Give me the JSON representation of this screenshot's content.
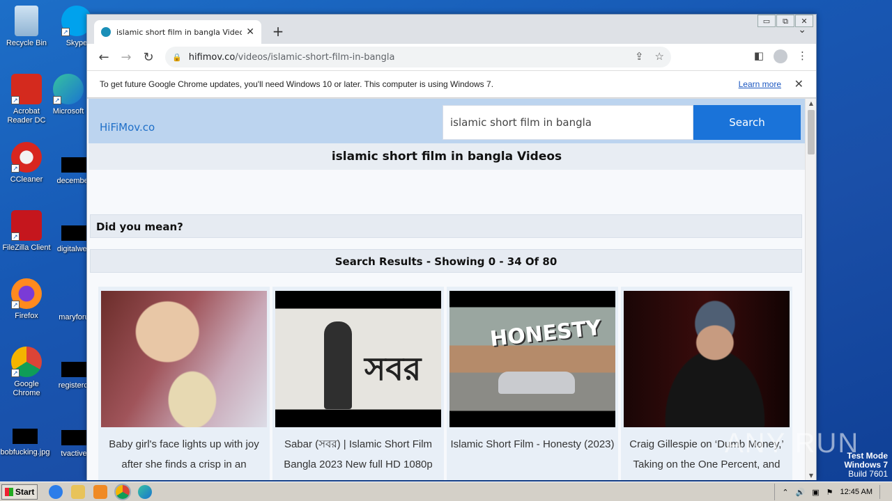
{
  "desktop": {
    "icons": [
      {
        "label": "Recycle Bin",
        "name": "recycle-bin-icon"
      },
      {
        "label": "Acrobat Reader DC",
        "name": "acrobat-icon"
      },
      {
        "label": "CCleaner",
        "name": "ccleaner-icon"
      },
      {
        "label": "FileZilla Client",
        "name": "filezilla-icon"
      },
      {
        "label": "Firefox",
        "name": "firefox-icon"
      },
      {
        "label": "Google Chrome",
        "name": "chrome-icon"
      },
      {
        "label": "bobfucking.jpg",
        "name": "file-icon"
      },
      {
        "label": "Skype",
        "name": "skype-icon"
      },
      {
        "label": "Microsoft",
        "name": "edge-icon"
      },
      {
        "label": "december",
        "name": "file-icon"
      },
      {
        "label": "digitalwes",
        "name": "file-icon"
      },
      {
        "label": "maryforu",
        "name": "file-icon"
      },
      {
        "label": "registercl",
        "name": "file-icon"
      },
      {
        "label": "tvactive",
        "name": "file-icon"
      }
    ]
  },
  "window": {
    "controls": [
      "▭",
      "⧉",
      "✕"
    ]
  },
  "browser": {
    "tab_title": "islamic short film in bangla Videos - H",
    "tab_close": "✕",
    "new_tab": "+",
    "tab_dropdown": "⌄",
    "back": "←",
    "forward": "→",
    "reload": "↻",
    "url_host": "hifimov.co",
    "url_path": "/videos/islamic-short-film-in-bangla",
    "infobar_text": "To get future Google Chrome updates, you'll need Windows 10 or later. This computer is using Windows 7.",
    "infobar_link": "Learn more",
    "infobar_close": "✕"
  },
  "site": {
    "logo": "HiFiMov.co",
    "search_value": "islamic short film in bangla",
    "search_button": "Search",
    "page_title": "islamic short film in bangla Videos",
    "did_you_mean": "Did you mean?",
    "results_summary": "Search Results - Showing 0 - 34 Of 80",
    "videos": [
      {
        "title": "Baby girl's face lights up with joy after she finds a crisp in an"
      },
      {
        "title": "Sabar (সবর) | Islamic Short Film Bangla 2023 New full HD 1080p"
      },
      {
        "title": "Islamic Short Film - Honesty (2023)"
      },
      {
        "title": "Craig Gillespie on ‘Dumb Money,’ Taking on the One Percent, and"
      }
    ],
    "thumb_text_2": "সবর",
    "thumb_text_3": "HONESTY"
  },
  "taskbar": {
    "start": "Start",
    "clock": "12:45 AM"
  },
  "watermark": {
    "line1": "Test Mode",
    "line2": "Windows 7",
    "line3": "Build 7601",
    "anyrun": "ANY RUN"
  }
}
